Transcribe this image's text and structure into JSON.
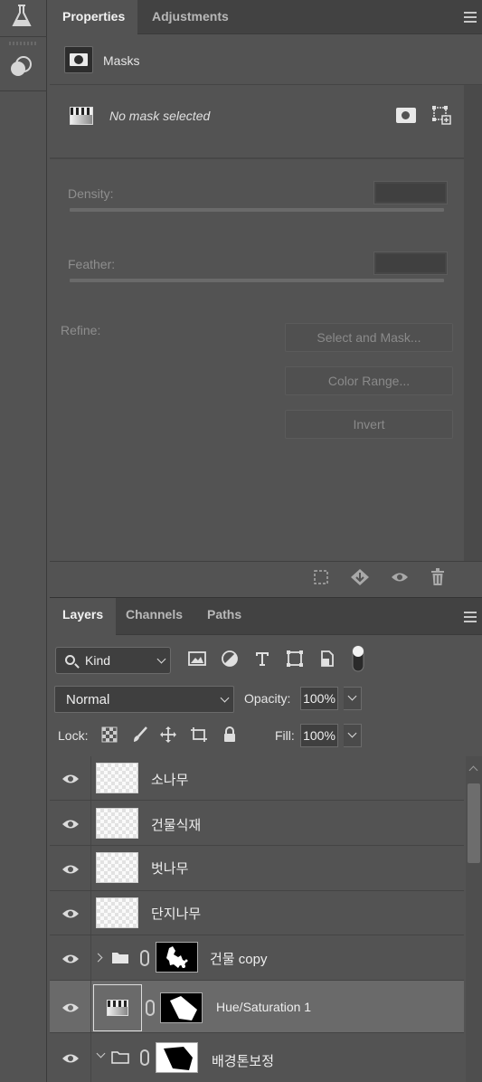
{
  "toolstrip": {
    "items": [
      {
        "icon": "flask-icon"
      },
      {
        "icon": "overlap-circles-icon"
      }
    ]
  },
  "properties": {
    "tabs": [
      {
        "label": "Properties",
        "active": true
      },
      {
        "label": "Adjustments",
        "active": false
      }
    ],
    "section_label": "Masks",
    "mask_status": "No mask selected",
    "density_label": "Density:",
    "feather_label": "Feather:",
    "refine_label": "Refine:",
    "buttons": {
      "select_and_mask": "Select and Mask...",
      "color_range": "Color Range...",
      "invert": "Invert"
    },
    "footer_icons": [
      "selection-from-mask-icon",
      "apply-mask-icon",
      "visibility-icon",
      "trash-icon"
    ]
  },
  "layers_panel": {
    "tabs": [
      {
        "label": "Layers",
        "active": true
      },
      {
        "label": "Channels",
        "active": false
      },
      {
        "label": "Paths",
        "active": false
      }
    ],
    "filter": {
      "kind_label": "Kind",
      "filter_icons": [
        "image-filter-icon",
        "adjustment-filter-icon",
        "type-filter-icon",
        "shape-filter-icon",
        "smart-object-filter-icon",
        "filter-toggle-icon"
      ]
    },
    "blend_mode": "Normal",
    "opacity_label": "Opacity:",
    "opacity_value": "100%",
    "lock_label": "Lock:",
    "fill_label": "Fill:",
    "fill_value": "100%",
    "layers": [
      {
        "name": "소나무",
        "type": "pixel",
        "visible": true,
        "selected": false
      },
      {
        "name": "건물식재",
        "type": "pixel",
        "visible": true,
        "selected": false
      },
      {
        "name": "벗나무",
        "type": "pixel",
        "visible": true,
        "selected": false
      },
      {
        "name": "단지나무",
        "type": "pixel",
        "visible": true,
        "selected": false
      },
      {
        "name": "건물 copy",
        "type": "group",
        "visible": true,
        "selected": false,
        "expanded": false
      },
      {
        "name": "Hue/Saturation 1",
        "type": "adjustment",
        "visible": true,
        "selected": true
      },
      {
        "name": "배경톤보정",
        "type": "group",
        "visible": true,
        "selected": false,
        "expanded": true
      }
    ]
  }
}
